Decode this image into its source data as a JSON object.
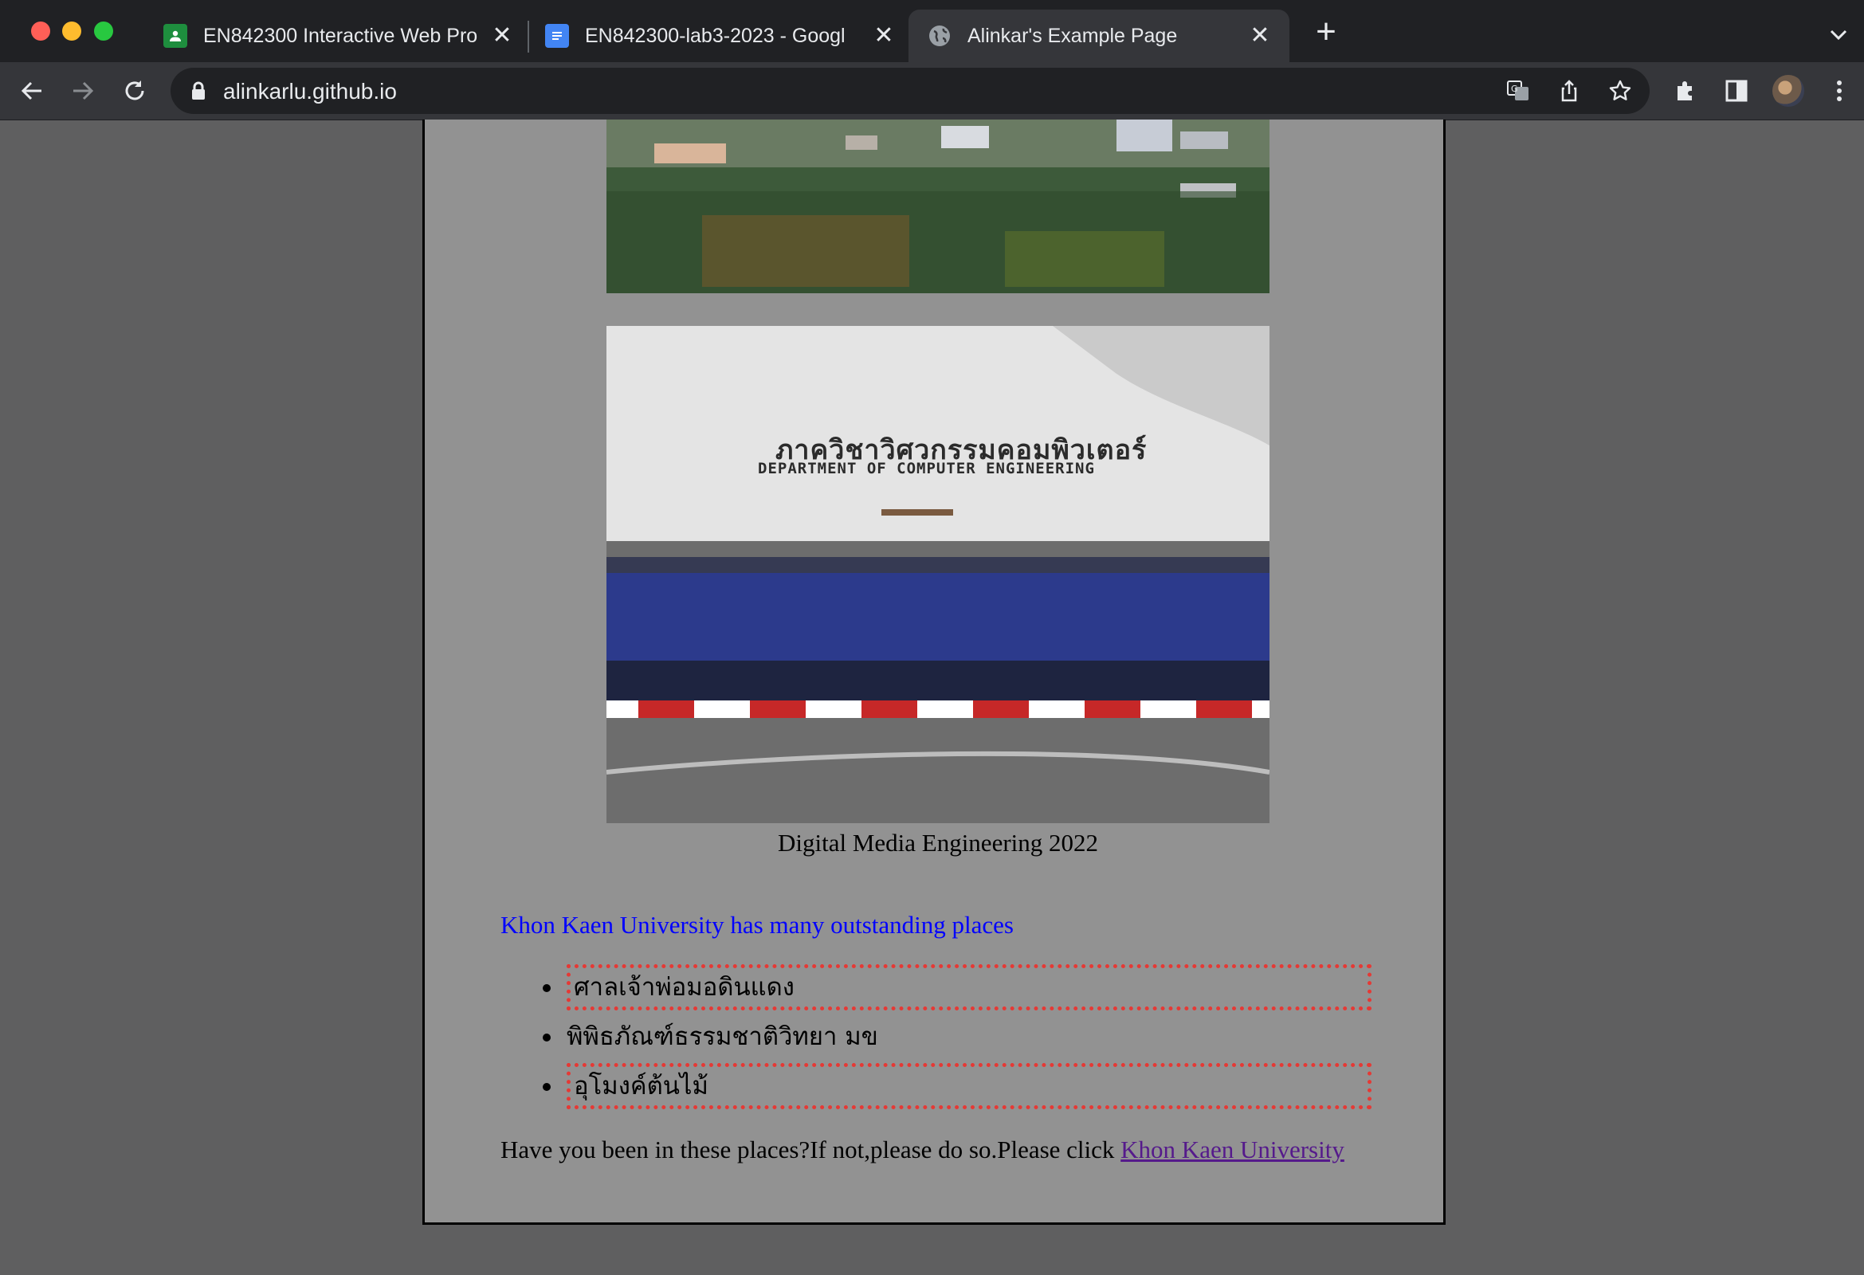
{
  "browser": {
    "tabs": [
      {
        "title": "EN842300 Interactive Web Pro",
        "icon": "google-classroom-icon",
        "close_label": "✕"
      },
      {
        "title": "EN842300-lab3-2023 - Googl",
        "icon": "google-docs-icon",
        "close_label": "✕"
      },
      {
        "title": "Alinkar's Example Page",
        "icon": "globe-icon",
        "close_label": "✕",
        "active": true
      }
    ],
    "new_tab_label": "+",
    "address": "alinkarlu.github.io",
    "colors": {
      "chrome_dark": "#202124",
      "toolbar": "#35363a",
      "text": "#e8eaed"
    }
  },
  "page": {
    "sign_thai": "ภาควิชาวิศวกรรมคอมพิวเตอร์",
    "sign_english": "DEPARTMENT OF COMPUTER ENGINEERING",
    "caption": "Digital Media Engineering 2022",
    "heading": "Khon Kaen University has many outstanding places",
    "places": [
      {
        "name": "ศาลเจ้าพ่อมอดินแดง",
        "dotted": true
      },
      {
        "name": "พิพิธภัณฑ์ธรรมชาติวิทยา มข",
        "dotted": false
      },
      {
        "name": "อุโมงค์ต้นไม้",
        "dotted": true
      }
    ],
    "footer_text": "Have you been in these places?If not,please do so.Please click ",
    "footer_link": "Khon Kaen University",
    "colors": {
      "background": "#929292",
      "heading": "#0000ff",
      "dotted_border": "#e53935",
      "link_visited": "#551a8b"
    }
  }
}
